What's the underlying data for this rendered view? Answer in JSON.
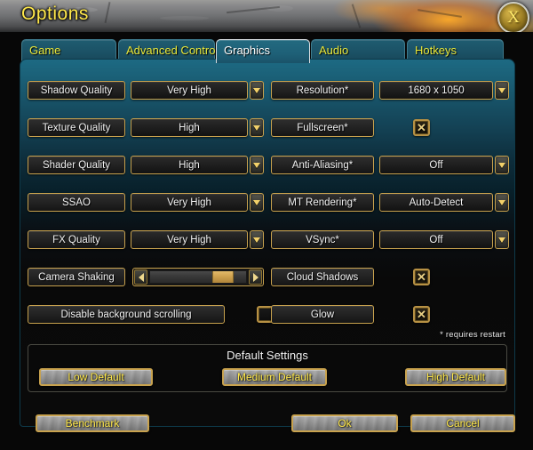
{
  "window": {
    "title": "Options",
    "close_icon": "close-x-icon",
    "close_label": "X"
  },
  "tabs": [
    {
      "label": "Game",
      "active": false
    },
    {
      "label": "Advanced Controls",
      "active": false
    },
    {
      "label": "Graphics",
      "active": true
    },
    {
      "label": "Audio",
      "active": false
    },
    {
      "label": "Hotkeys",
      "active": false
    }
  ],
  "settings": {
    "left_column": [
      {
        "label": "Shadow Quality",
        "type": "dropdown",
        "value": "Very High"
      },
      {
        "label": "Texture Quality",
        "type": "dropdown",
        "value": "High"
      },
      {
        "label": "Shader Quality",
        "type": "dropdown",
        "value": "High"
      },
      {
        "label": "SSAO",
        "type": "dropdown",
        "value": "Very High"
      },
      {
        "label": "FX Quality",
        "type": "dropdown",
        "value": "Very High"
      },
      {
        "label": "Camera Shaking",
        "type": "slider",
        "value": 85
      }
    ],
    "right_column": [
      {
        "label": "Resolution*",
        "type": "dropdown",
        "value": "1680 x 1050"
      },
      {
        "label": "Fullscreen*",
        "type": "checkbox",
        "checked": true
      },
      {
        "label": "Anti-Aliasing*",
        "type": "dropdown",
        "value": "Off"
      },
      {
        "label": "MT Rendering*",
        "type": "dropdown",
        "value": "Auto-Detect"
      },
      {
        "label": "VSync*",
        "type": "dropdown",
        "value": "Off"
      },
      {
        "label": "Cloud Shadows",
        "type": "checkbox",
        "checked": true
      },
      {
        "label": "Glow",
        "type": "checkbox",
        "checked": true
      }
    ],
    "wide_row": {
      "label": "Disable background scrolling",
      "type": "checkbox",
      "checked": false
    }
  },
  "checkbox_glyphs": {
    "checked": "✕",
    "unchecked": ""
  },
  "restart_note": "* requires restart",
  "default_settings": {
    "title": "Default Settings",
    "buttons": [
      "Low Default",
      "Medium Default",
      "High Default"
    ]
  },
  "actions": {
    "benchmark": "Benchmark",
    "ok": "Ok",
    "cancel": "Cancel"
  },
  "colors": {
    "accent_gold": "#c8a24e",
    "title_yellow": "#ffe84a",
    "tab_teal": "#1f5c70",
    "panel_top": "#1d6a83"
  }
}
